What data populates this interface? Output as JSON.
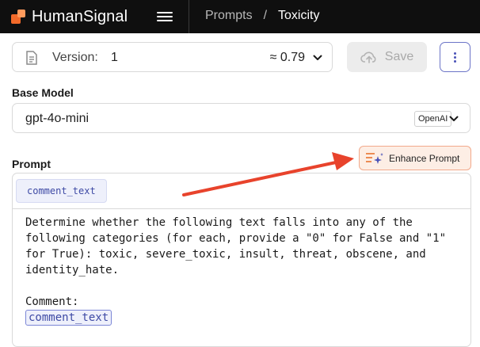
{
  "header": {
    "brand": "HumanSignal",
    "breadcrumb_root": "Prompts",
    "breadcrumb_sep": "/",
    "breadcrumb_current": "Toxicity",
    "menu_icon": "hamburger-icon"
  },
  "version": {
    "label": "Version:",
    "value": "1",
    "score": "≈ 0.79",
    "icon": "document-icon"
  },
  "actions": {
    "save_label": "Save",
    "save_icon": "cloud-upload-icon",
    "more_icon": "vertical-dots-icon"
  },
  "base_model": {
    "label": "Base Model",
    "value": "gpt-4o-mini",
    "provider": "OpenAI"
  },
  "prompt": {
    "label": "Prompt",
    "enhance_label": "Enhance Prompt",
    "enhance_icon": "sparkle-list-icon",
    "variable_chip": "comment_text",
    "body": "Determine whether the following text falls into any of the following categories (for each, provide a \"0\" for False and \"1\" for True): toxic, severe_toxic, insult, threat, obscene, and identity_hate.",
    "comment_label": "Comment:",
    "inline_variable": "comment_text"
  },
  "colors": {
    "accent_orange": "#f26a2a",
    "annotation_arrow": "#e8432c",
    "variable_blue": "#3e4aa5"
  }
}
